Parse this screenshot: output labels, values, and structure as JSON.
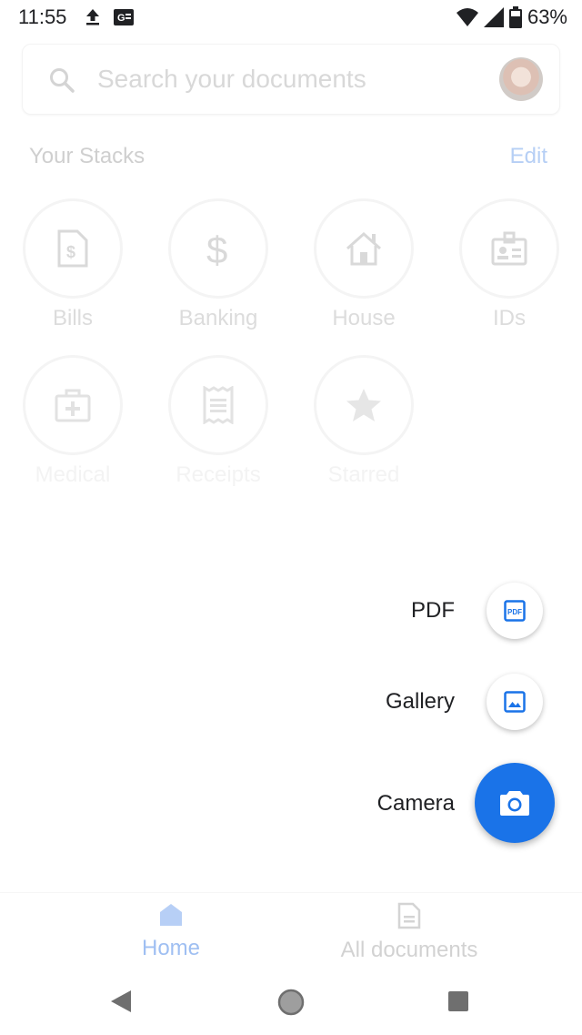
{
  "status_bar": {
    "time": "11:55",
    "battery": "63%",
    "icons": [
      "upload-icon",
      "ge-icon",
      "wifi-icon",
      "signal-icon",
      "battery-icon"
    ]
  },
  "search": {
    "placeholder": "Search your documents"
  },
  "stacks": {
    "title": "Your Stacks",
    "edit_label": "Edit",
    "items": [
      {
        "label": "Bills",
        "icon": "bill-icon"
      },
      {
        "label": "Banking",
        "icon": "dollar-icon"
      },
      {
        "label": "House",
        "icon": "house-icon"
      },
      {
        "label": "IDs",
        "icon": "id-card-icon"
      },
      {
        "label": "Medical",
        "icon": "medical-kit-icon"
      },
      {
        "label": "Receipts",
        "icon": "receipt-icon"
      },
      {
        "label": "Starred",
        "icon": "star-icon"
      }
    ]
  },
  "fab_menu": {
    "pdf_label": "PDF",
    "gallery_label": "Gallery",
    "camera_label": "Camera"
  },
  "bottom_nav": {
    "home_label": "Home",
    "all_documents_label": "All documents"
  },
  "colors": {
    "accent": "#1a73e8",
    "dimmed_text": "#dcdcdc",
    "edit_link": "#b6cff5"
  }
}
